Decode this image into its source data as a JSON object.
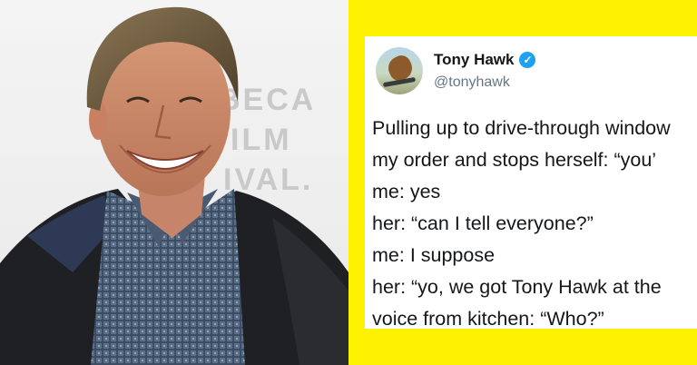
{
  "backdrop": {
    "line1": "BECA",
    "line2": "ILM",
    "line3": "IVAL."
  },
  "tweet": {
    "author_name": "Tony Hawk",
    "verified_symbol": "✓",
    "handle": "@tonyhawk",
    "lines": [
      "Pulling up to drive-through window",
      "my order and stops herself: “you’",
      "me: yes",
      "her: “can I tell everyone?”",
      "me: I suppose",
      "her: “yo, we got Tony Hawk at the",
      "voice from kitchen: “Who?”"
    ]
  },
  "colors": {
    "accent_yellow": "#fff200",
    "verified_blue": "#1da1f2"
  }
}
